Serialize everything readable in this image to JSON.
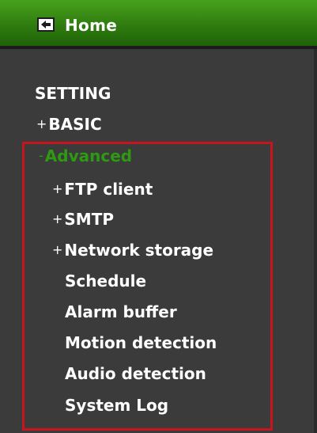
{
  "header": {
    "home_label": "Home",
    "home_icon": "back-arrow-icon"
  },
  "menu": {
    "title": "SETTING",
    "basic": {
      "sign": "+",
      "label": "BASIC"
    },
    "advanced": {
      "sign": "-",
      "label": "Advanced",
      "color": "#2e9a12",
      "highlight_color": "#c8141c",
      "items": [
        {
          "sign": "+",
          "label": "FTP client"
        },
        {
          "sign": "+",
          "label": "SMTP"
        },
        {
          "sign": "+",
          "label": "Network storage"
        },
        {
          "sign": "",
          "label": "Schedule"
        },
        {
          "sign": "",
          "label": "Alarm buffer"
        },
        {
          "sign": "",
          "label": "Motion detection"
        },
        {
          "sign": "",
          "label": "Audio detection"
        },
        {
          "sign": "",
          "label": "System Log"
        }
      ]
    }
  },
  "colors": {
    "background": "#3b3b3b",
    "header_green": "#2f7c0f",
    "text": "#ffffff"
  }
}
